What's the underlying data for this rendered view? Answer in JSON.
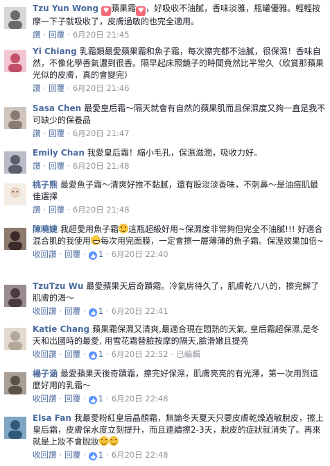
{
  "comments": [
    {
      "name": "Tzu Yun Wong",
      "text_a": "",
      "text_b": "蘋果霜",
      "text_c": "，好吸收不油膩，香味淡雅，瓶罐優雅。輕輕按摩一下子就吸收了，皮膚過敏的也完全適用。",
      "reply": "讚",
      "answer": "回覆",
      "time": "6月20日 21:45",
      "avatar_color": "#6a6a6a"
    },
    {
      "name": "Yi Chiang",
      "text": "乳霜類最愛蘋果霜和魚子霜，每次擦完都不油膩，很保濕！香味自然，不像化學香氣濃到很香。隔早起床照鏡子的時間竟然比平常久（欣賞那蘋果光似的皮膚，真的會變完）",
      "reply": "讚",
      "answer": "回覆",
      "time": "6月20日 21:46",
      "avatar_color": "#c2506b"
    },
    {
      "name": "Sasa Chen",
      "text": "最愛皇后霜～隔天就會有自然的蘋果肌而且保濕度又夠一直是我不可缺少的保養品",
      "reply": "讚",
      "answer": "回覆",
      "time": "6月20日 21:47",
      "avatar_color": "#8a7c72"
    },
    {
      "name": "Emily Chan",
      "text": "我愛皇后霜！縮小毛孔，保濕滋潤，吸收力好。",
      "reply": "讚",
      "answer": "回覆",
      "time": "6月20日 21:48",
      "avatar_color": "#5b5e6a"
    },
    {
      "name": "桃子熊",
      "text": "最愛魚子霜～清爽好推不黏膩，還有股淡淡香味，不刺鼻～是油痘肌最佳選擇",
      "reply": "讚",
      "answer": "回覆",
      "time": "6月20日 21:48",
      "avatar_color": "#e8d7c9"
    },
    {
      "name": "陳曉婕",
      "text_a": "我超愛用魚子霜",
      "text_b": "這瓶超級好用~保濕度非常夠但完全不油膩!!! 好適合混合肌的我使用",
      "text_c": "每次用完面膜，一定會擦一層薄薄的魚子霜。保溼效果加倍~",
      "reply": "收回讚",
      "answer": "回覆",
      "likes": "1",
      "time": "6月20日 22:40",
      "avatar_color": "#3b2a2a"
    },
    {
      "name": "TzuTzu Wu",
      "text": "最愛蘋果天后奇蹟霜。冷氣房待久了，肌膚乾八八的，擦完解了肌膚的渴～",
      "reply": "收回讚",
      "answer": "回覆",
      "likes": "1",
      "time": "6月20日 22:41",
      "avatar_color": "#4a3b3e"
    },
    {
      "name": "Katie Chang",
      "text": "蘋果霜保濕又清爽,最適合現在悶熱的天氣, 皇后霜超保濕,是冬天和出國時的最愛, 用雪花霜替臉按摩的隔天,臉滑嫩且提亮",
      "reply": "收回讚",
      "answer": "回覆",
      "likes": "1",
      "time": "6月20日 22:52",
      "edited": "已編輯",
      "avatar_color": "#b5a79a"
    },
    {
      "name": "楊子涵",
      "text": "最愛蘋果天後奇蹟霜，擦完好保濕，肌膚亮亮的有光澤，第一次用到這麼好用的乳霜～",
      "reply": "收回讚",
      "answer": "回覆",
      "likes": "1",
      "time": "6月20日 22:48",
      "avatar_color": "#5a5148"
    },
    {
      "name": "Elsa Fan",
      "text_a": "我最愛粉紅皇后晶顏霜，無論冬天夏天只要皮膚乾燥過敏脫皮，擦上皇后霜，皮膚保水度立刻提升，而且連續擦2-3天，脫皮的症狀就消失了。再來就是上妝不會脫妝",
      "reply": "收回讚",
      "answer": "回覆",
      "likes": "1",
      "time": "6月20日 22:48",
      "avatar_color": "#2f5a7a"
    }
  ]
}
